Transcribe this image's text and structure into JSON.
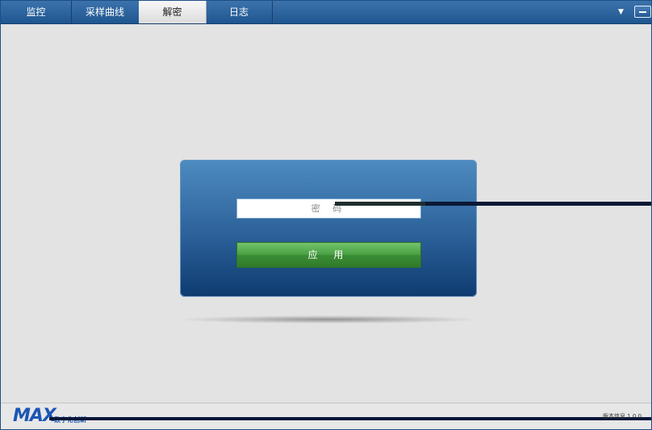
{
  "tabs": [
    {
      "label": "监控"
    },
    {
      "label": "采样曲线"
    },
    {
      "label": "解密"
    },
    {
      "label": "日志"
    }
  ],
  "active_tab": "解密",
  "window_controls": {
    "dropdown": "▼",
    "minimize": "−",
    "close": "✕"
  },
  "unlock_form": {
    "password_placeholder": "密 码",
    "apply_label": "应 用"
  },
  "footer": {
    "logo_text": "MAX",
    "logo_subtext": "数字化创新",
    "right_text": "版本信息  1.0.0"
  },
  "colors": {
    "topbar": "#2a629c",
    "card_top": "#4d8bc1",
    "card_bottom": "#0d3b70",
    "apply_green": "#4ca144",
    "logo_blue": "#1b56b5"
  }
}
